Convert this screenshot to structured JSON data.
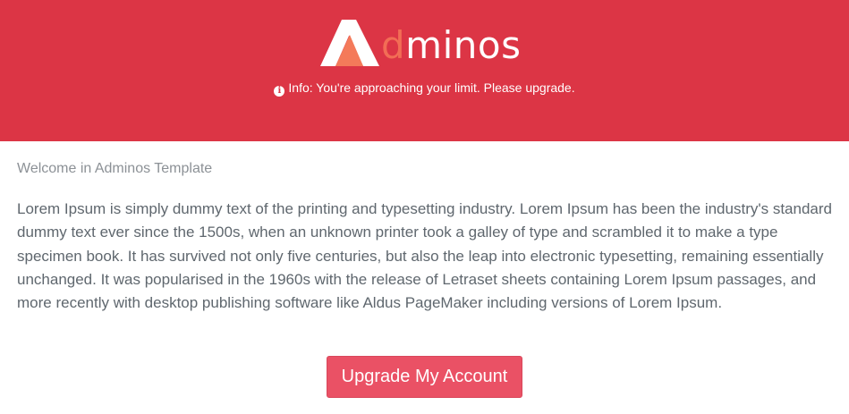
{
  "header": {
    "logo": {
      "prefix_letter": "d",
      "suffix": "minos",
      "mark_icon": "triangle-a-logo"
    },
    "info_icon": "info-circle-icon",
    "info_text": "Info: You're approaching your limit. Please upgrade."
  },
  "main": {
    "welcome": "Welcome in Adminos Template",
    "paragraph": "Lorem Ipsum is simply dummy text of the printing and typesetting industry. Lorem Ipsum has been the industry's standard dummy text ever since the 1500s, when an unknown printer took a galley of type and scrambled it to make a type specimen book. It has survived not only five centuries, but also the leap into electronic typesetting, remaining essentially unchanged. It was popularised in the 1960s with the release of Letraset sheets containing Lorem Ipsum passages, and more recently with desktop publishing software like Aldus PageMaker including versions of Lorem Ipsum.",
    "upgrade_button": "Upgrade My Account"
  },
  "colors": {
    "header_bg": "#dc3545",
    "logo_accent": "#f26d55",
    "button_bg": "#ea5165",
    "text": "#5f676e"
  }
}
